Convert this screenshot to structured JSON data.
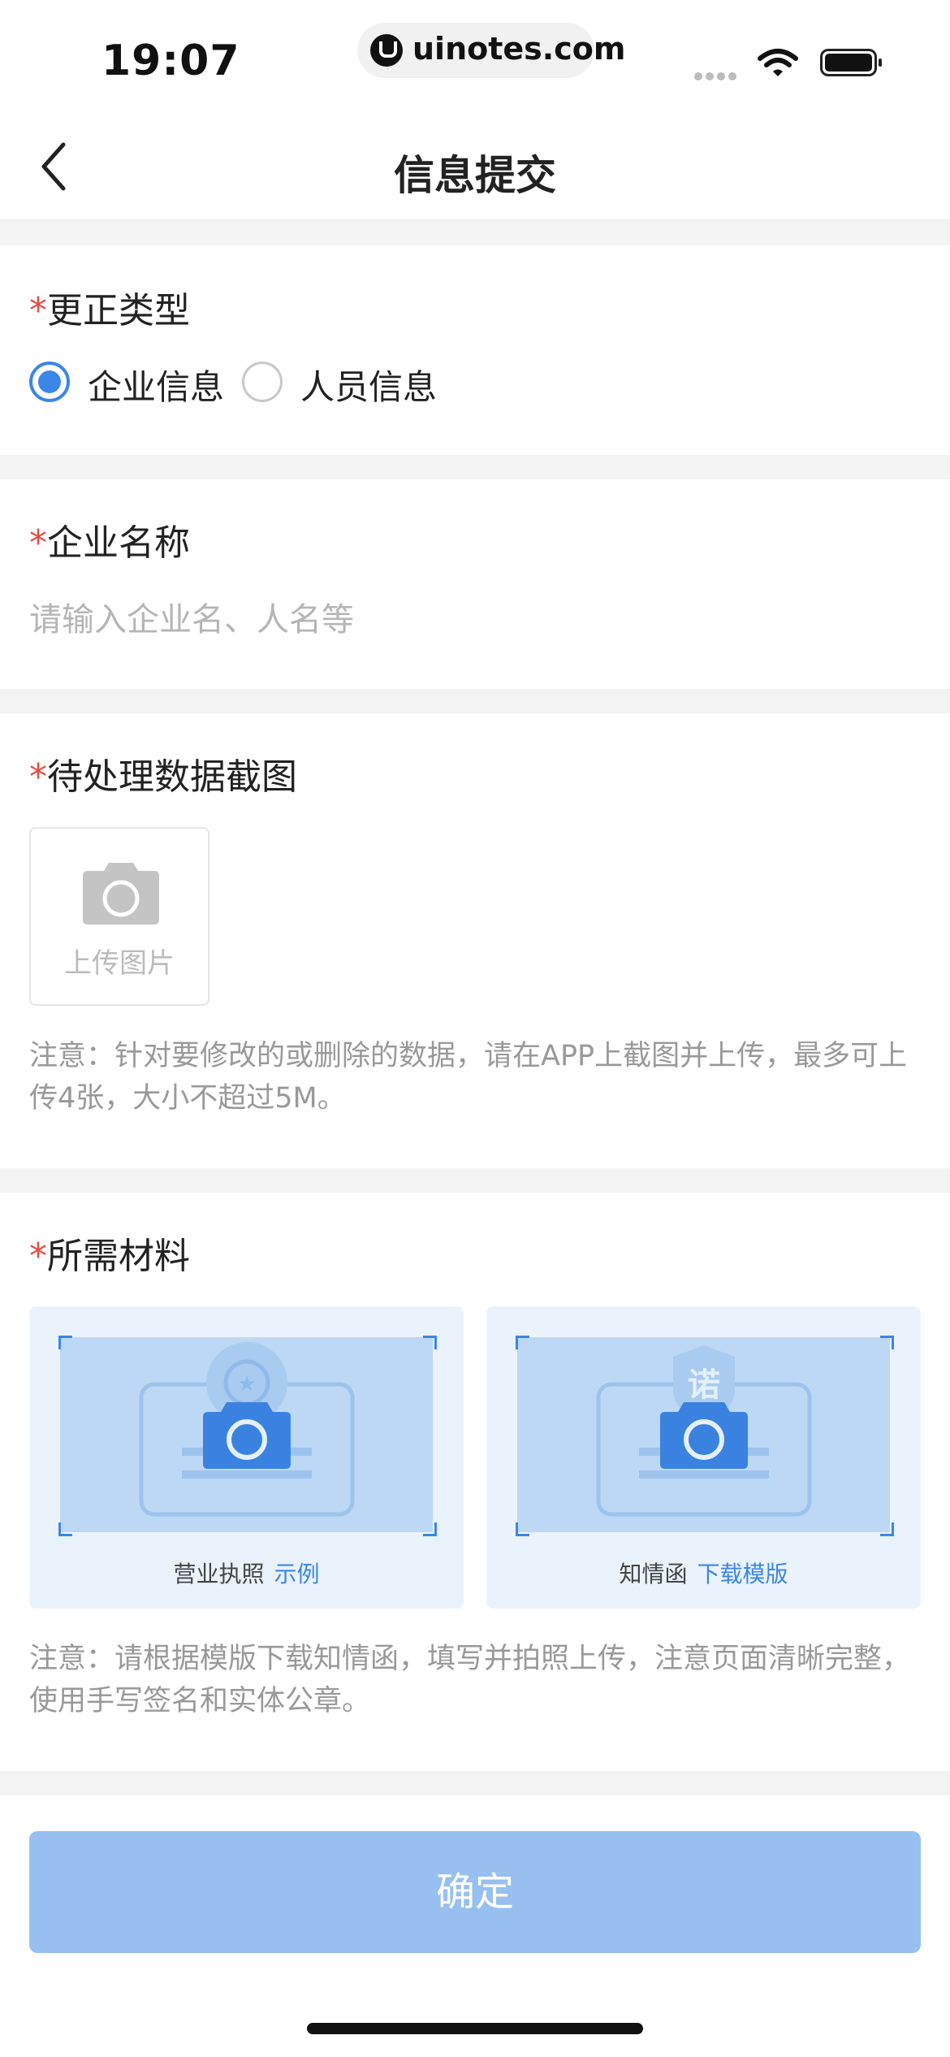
{
  "status_bar": {
    "time": "19:07",
    "url": "uinotes.com"
  },
  "nav": {
    "title": "信息提交",
    "back_icon": "chevron-left-icon"
  },
  "correction_type": {
    "required_mark": "*",
    "label": "更正类型",
    "options": [
      {
        "label": "企业信息",
        "selected": true
      },
      {
        "label": "人员信息",
        "selected": false
      }
    ]
  },
  "company_name": {
    "required_mark": "*",
    "label": "企业名称",
    "placeholder": "请输入企业名、人名等"
  },
  "screenshot": {
    "required_mark": "*",
    "label": "待处理数据截图",
    "upload_label": "上传图片",
    "note": "注意：针对要修改的或删除的数据，请在APP上截图并上传，最多可上传4张，大小不超过5M。"
  },
  "materials": {
    "required_mark": "*",
    "label": "所需材料",
    "items": [
      {
        "caption": "营业执照",
        "link": "示例",
        "badge_char": "★"
      },
      {
        "caption": "知情函",
        "link": "下载模版",
        "badge_char": "诺"
      }
    ],
    "note": "注意：请根据模版下载知情函，填写并拍照上传，注意页面清晰完整，使用手写签名和实体公章。"
  },
  "confirm_label": "确定",
  "colors": {
    "accent": "#3b86e8",
    "required": "#e54d42",
    "button_disabled": "#97c0f0"
  }
}
